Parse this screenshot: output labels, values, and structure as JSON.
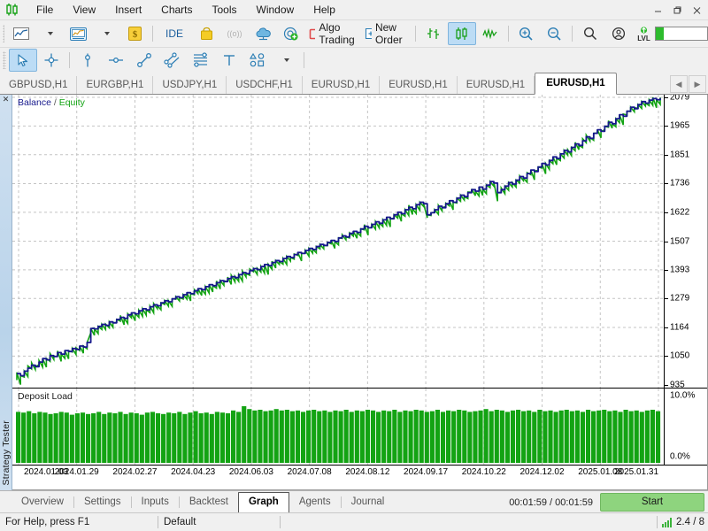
{
  "window": {
    "minimize": "—",
    "restore": "❐",
    "close": "✕"
  },
  "menu": {
    "logo_icon": "metatrader-logo-icon",
    "items": [
      {
        "label": "File"
      },
      {
        "label": "View"
      },
      {
        "label": "Insert"
      },
      {
        "label": "Charts"
      },
      {
        "label": "Tools"
      },
      {
        "label": "Window"
      },
      {
        "label": "Help"
      }
    ]
  },
  "toolbar_main": {
    "items": [
      {
        "name": "chart-type-line-button",
        "icon": "line-chart-icon",
        "label": ""
      },
      {
        "name": "chart-type-dropdown",
        "icon": "chevron-down-icon",
        "label": ""
      },
      {
        "name": "templates-button",
        "icon": "chart-template-icon",
        "label": ""
      },
      {
        "name": "templates-dropdown",
        "icon": "chevron-down-icon",
        "label": ""
      },
      {
        "name": "dollar-button",
        "icon": "dollar-coin-icon",
        "label": ""
      },
      {
        "name": "ide-button",
        "icon": "",
        "label": "IDE"
      },
      {
        "name": "market-button",
        "icon": "shopping-bag-icon",
        "label": ""
      },
      {
        "name": "signals-button",
        "icon": "broadcast-icon",
        "label": ""
      },
      {
        "name": "vps-button",
        "icon": "cloud-icon",
        "label": ""
      },
      {
        "name": "add-terminal-button",
        "icon": "radar-plus-icon",
        "label": ""
      },
      {
        "name": "algo-trading-button",
        "icon": "stop-square-icon",
        "label": "Algo Trading"
      },
      {
        "name": "new-order-button",
        "icon": "new-order-icon",
        "label": "New Order"
      },
      {
        "name": "bar-chart-button",
        "icon": "bar-chart-icon",
        "label": ""
      },
      {
        "name": "candlestick-chart-button",
        "icon": "candlestick-icon",
        "label": ""
      },
      {
        "name": "line-chart-button",
        "icon": "zigzag-line-icon",
        "label": ""
      },
      {
        "name": "zoom-in-button",
        "icon": "magnifier-plus-icon",
        "label": ""
      },
      {
        "name": "zoom-out-button",
        "icon": "magnifier-minus-icon",
        "label": ""
      },
      {
        "name": "search-button",
        "icon": "search-icon",
        "label": ""
      },
      {
        "name": "account-button",
        "icon": "user-circle-icon",
        "label": ""
      },
      {
        "name": "level-indicator",
        "icon": "lvl-icon",
        "label": "LVL"
      }
    ],
    "active_item": "candlestick-chart-button"
  },
  "toolbar_objects": {
    "items": [
      {
        "name": "cursor-tool",
        "icon": "arrow-cursor-icon"
      },
      {
        "name": "crosshair-tool",
        "icon": "crosshair-icon"
      },
      {
        "name": "vertical-line-tool",
        "icon": "vertical-line-icon"
      },
      {
        "name": "horizontal-line-tool",
        "icon": "horizontal-line-icon"
      },
      {
        "name": "trendline-tool",
        "icon": "trendline-icon"
      },
      {
        "name": "equidistant-channel-tool",
        "icon": "channel-icon"
      },
      {
        "name": "fibonacci-tool",
        "icon": "fibonacci-icon"
      },
      {
        "name": "text-tool",
        "icon": "text-icon"
      },
      {
        "name": "shapes-tool",
        "icon": "shapes-icon"
      },
      {
        "name": "shapes-dropdown",
        "icon": "chevron-down-icon"
      }
    ],
    "active_item": "cursor-tool"
  },
  "chart_tabs": {
    "items": [
      {
        "label": "GBPUSD,H1"
      },
      {
        "label": "EURGBP,H1"
      },
      {
        "label": "USDJPY,H1"
      },
      {
        "label": "USDCHF,H1"
      },
      {
        "label": "EURUSD,H1"
      },
      {
        "label": "EURUSD,H1"
      },
      {
        "label": "EURUSD,H1"
      },
      {
        "label": "EURUSD,H1"
      }
    ],
    "active_index": 7,
    "nav_prev": "◀",
    "nav_next": "▶"
  },
  "sidebar": {
    "title": "Strategy Tester",
    "close_icon": "✕"
  },
  "tester_tabs": {
    "items": [
      {
        "label": "Overview"
      },
      {
        "label": "Settings"
      },
      {
        "label": "Inputs"
      },
      {
        "label": "Backtest"
      },
      {
        "label": "Graph"
      },
      {
        "label": "Agents"
      },
      {
        "label": "Journal"
      }
    ],
    "active_index": 4,
    "elapsed": "00:01:59 / 00:01:59",
    "start_button": "Start"
  },
  "statusbar": {
    "help": "For Help, press F1",
    "profile": "Default",
    "traffic": "2.4 / 8",
    "signal_icon": "signal-bars-icon"
  },
  "chart_data": {
    "type": "line",
    "title": "Balance / Equity",
    "legend": {
      "balance_label": "Balance",
      "separator": "/",
      "equity_label": "Equity",
      "balance_color": "#16188c",
      "equity_color": "#13a313",
      "position": "top-left"
    },
    "xlabel": "",
    "ylabel": "",
    "grid": true,
    "ylim": [
      935,
      2079
    ],
    "yticks": [
      2079,
      1965,
      1851,
      1736,
      1622,
      1507,
      1393,
      1279,
      1164,
      1050,
      935
    ],
    "xticks": [
      "2024.01.03",
      "2024.01.29",
      "2024.02.27",
      "2024.04.23",
      "2024.06.03",
      "2024.07.08",
      "2024.08.12",
      "2024.09.17",
      "2024.10.22",
      "2024.12.02",
      "2025.01.08",
      "2025.01.31"
    ],
    "series": [
      {
        "name": "Balance",
        "color": "#16188c",
        "values": [
          980,
          972,
          990,
          1002,
          1014,
          1008,
          1026,
          1040,
          1035,
          1052,
          1048,
          1064,
          1058,
          1072,
          1068,
          1080,
          1076,
          1090,
          1086,
          1104,
          1160,
          1158,
          1168,
          1176,
          1172,
          1186,
          1182,
          1196,
          1204,
          1200,
          1214,
          1222,
          1218,
          1230,
          1238,
          1234,
          1246,
          1254,
          1250,
          1262,
          1270,
          1266,
          1278,
          1286,
          1282,
          1294,
          1302,
          1298,
          1310,
          1318,
          1314,
          1326,
          1334,
          1330,
          1342,
          1350,
          1346,
          1358,
          1366,
          1362,
          1374,
          1382,
          1378,
          1390,
          1398,
          1394,
          1406,
          1414,
          1410,
          1422,
          1430,
          1426,
          1438,
          1446,
          1442,
          1454,
          1462,
          1458,
          1470,
          1478,
          1474,
          1486,
          1494,
          1490,
          1502,
          1510,
          1506,
          1520,
          1528,
          1524,
          1538,
          1546,
          1542,
          1556,
          1566,
          1560,
          1574,
          1584,
          1578,
          1592,
          1602,
          1596,
          1612,
          1622,
          1616,
          1632,
          1642,
          1636,
          1652,
          1662,
          1656,
          1612,
          1620,
          1632,
          1646,
          1640,
          1656,
          1668,
          1662,
          1678,
          1690,
          1684,
          1700,
          1712,
          1706,
          1722,
          1714,
          1730,
          1744,
          1738,
          1700,
          1712,
          1726,
          1740,
          1734,
          1750,
          1764,
          1758,
          1776,
          1790,
          1784,
          1802,
          1816,
          1810,
          1828,
          1842,
          1836,
          1854,
          1868,
          1862,
          1880,
          1894,
          1888,
          1906,
          1922,
          1916,
          1936,
          1950,
          1944,
          1964,
          1980,
          1974,
          1994,
          2010,
          2004,
          2024,
          2040,
          2034,
          2050,
          2062,
          2056,
          2068,
          2074,
          2070,
          2076
        ]
      },
      {
        "name": "Equity",
        "color": "#13a313",
        "note": "equity plotted as fluctuation spikes around the balance line"
      }
    ]
  },
  "deposit_load": {
    "type": "bar",
    "title": "Deposit Load",
    "ylim": [
      0,
      10
    ],
    "ytick_top": "10.0%",
    "ytick_bottom": "0.0%",
    "bar_color": "#13a313",
    "values": [
      7.2,
      7.1,
      7.3,
      7.0,
      7.2,
      7.1,
      6.9,
      7.0,
      7.2,
      7.1,
      6.8,
      7.0,
      7.1,
      6.9,
      7.0,
      7.2,
      6.9,
      7.1,
      7.0,
      7.2,
      6.9,
      7.1,
      7.0,
      6.8,
      7.1,
      7.2,
      7.0,
      6.9,
      7.1,
      7.0,
      7.2,
      6.9,
      7.1,
      7.3,
      7.0,
      7.1,
      6.9,
      7.2,
      7.1,
      7.0,
      7.4,
      7.2,
      8.0,
      7.6,
      7.4,
      7.5,
      7.3,
      7.4,
      7.6,
      7.4,
      7.5,
      7.3,
      7.4,
      7.2,
      7.4,
      7.5,
      7.3,
      7.4,
      7.2,
      7.4,
      7.3,
      7.5,
      7.2,
      7.4,
      7.3,
      7.5,
      7.4,
      7.2,
      7.4,
      7.3,
      7.5,
      7.2,
      7.4,
      7.3,
      7.5,
      7.4,
      7.2,
      7.3,
      7.5,
      7.2,
      7.4,
      7.3,
      7.5,
      7.4,
      7.2,
      7.3,
      7.4,
      7.6,
      7.3,
      7.5,
      7.4,
      7.2,
      7.4,
      7.5,
      7.3,
      7.4,
      7.2,
      7.5,
      7.3,
      7.4,
      7.2,
      7.4,
      7.5,
      7.3,
      7.4,
      7.2,
      7.5,
      7.3,
      7.4,
      7.5,
      7.3,
      7.4,
      7.2,
      7.5,
      7.3,
      7.4,
      7.2,
      7.4,
      7.5,
      7.3
    ]
  }
}
